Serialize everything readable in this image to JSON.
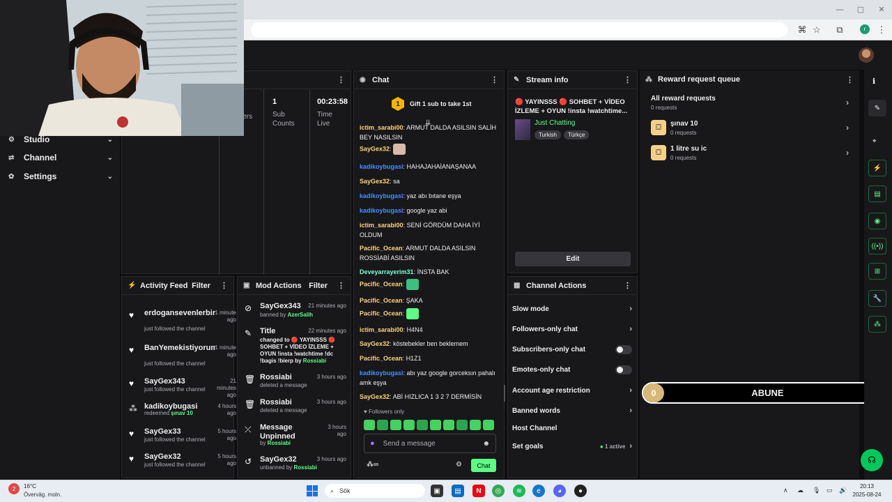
{
  "browser": {
    "window_controls": [
      "—",
      "▢",
      "✕"
    ]
  },
  "sidebar": {
    "items": [
      {
        "label": "Studio",
        "icon": "studio-icon"
      },
      {
        "label": "Channel",
        "icon": "channel-icon"
      },
      {
        "label": "Settings",
        "icon": "gear-icon"
      }
    ]
  },
  "stats": {
    "partial_label": "wers",
    "sub_value": "1",
    "sub_label": "Sub Counts",
    "time_value": "00:23:58",
    "time_label": "Time Live"
  },
  "chat": {
    "title": "Chat",
    "gift_banner": "Gift 1 sub to take 1st",
    "gift_count": "1",
    "messages": [
      {
        "user": "ictim_sarabi00",
        "color": "#ffd37a",
        "text": "ARMUT DALDA ASILSIN SALİH BEY NASILSIN"
      },
      {
        "user": "SayGex32",
        "color": "#ffd37a",
        "text": ""
      },
      {
        "user": "kadikoybugasi",
        "color": "#4a8cff",
        "text": "HAHAJAHAİANAŞANAA"
      },
      {
        "user": "SayGex32",
        "color": "#ffd37a",
        "text": "sa"
      },
      {
        "user": "kadikoybugasi",
        "color": "#4a8cff",
        "text": "yaz abı bıtane eşya"
      },
      {
        "user": "kadikoybugasi",
        "color": "#4a8cff",
        "text": "google yaz abi"
      },
      {
        "user": "ictim_sarabi00",
        "color": "#ffd37a",
        "text": "SENİ GÖRDÜM DAHA İYİ OLDUM"
      },
      {
        "user": "Pacific_Ocean",
        "color": "#ffd37a",
        "text": "ARMUT DALDA ASILSIN ROSSİABİ ASILSIN"
      },
      {
        "user": "Deveyarrayerim31",
        "color": "#7fffd4",
        "text": "İNSTA BAK"
      },
      {
        "user": "Pacific_Ocean",
        "color": "#ffd37a",
        "text": ""
      },
      {
        "user": "Pacific_Ocean",
        "color": "#ffd37a",
        "text": "ŞAKA"
      },
      {
        "user": "Pacific_Ocean",
        "color": "#ffd37a",
        "text": ""
      },
      {
        "user": "ictim_sarabi00",
        "color": "#ffd37a",
        "text": "H4N4"
      },
      {
        "user": "SayGex32",
        "color": "#ffd37a",
        "text": "köstebekler ben beklemem"
      },
      {
        "user": "Pacific_Ocean",
        "color": "#ffd37a",
        "text": "H1Z1"
      },
      {
        "user": "kadikoybugasi",
        "color": "#4a8cff",
        "text": "abı yaz google gorceksın pahalı amk eşya"
      },
      {
        "user": "SayGex32",
        "color": "#ffd37a",
        "text": "ABİ HIZLICA 1 3 2 7 DERMİSİN"
      }
    ],
    "followers_only": "Followers only",
    "placeholder": "Send a message",
    "chat_button": "Chat"
  },
  "stream_info": {
    "title": "Stream info",
    "stream_title": "🔴 YAYINSSS 🔴 SOHBET + VİDEO İZLEME + OYUN !insta !watchtime...",
    "category": "Just Chatting",
    "tags": [
      "Turkish",
      "Türkçe"
    ],
    "edit_button": "Edit"
  },
  "reward_queue": {
    "title": "Reward request queue",
    "all_label": "All reward requests",
    "all_count": "0 requests",
    "rewards": [
      {
        "name": "şınav 10",
        "count": "0 requests"
      },
      {
        "name": "1 litre su ic",
        "count": "0 requests"
      }
    ]
  },
  "activity_feed": {
    "title": "Activity Feed",
    "filter": "Filter",
    "items": [
      {
        "name": "erdogansevenlerbirligi",
        "time": "1 minute ago",
        "sub": "just followed the channel",
        "icon": "heart-icon"
      },
      {
        "name": "BanYemekistiyorum32",
        "time": "1 minute ago",
        "sub": "just followed the channel",
        "icon": "heart-icon"
      },
      {
        "name": "SayGex343",
        "time": "21 minutes ago",
        "sub": "just followed the channel",
        "icon": "heart-icon"
      },
      {
        "name": "kadikoybugasi",
        "time": "4 hours ago",
        "sub": "redeemed",
        "reward": "şınav 10",
        "icon": "points-icon"
      },
      {
        "name": "SayGex33",
        "time": "5 hours ago",
        "sub": "just followed the channel",
        "icon": "heart-icon"
      },
      {
        "name": "SayGex32",
        "time": "5 hours ago",
        "sub": "just followed the channel",
        "icon": "heart-icon"
      }
    ]
  },
  "mod_actions": {
    "title": "Mod Actions",
    "filter": "Filter",
    "items": [
      {
        "name": "SayGex343",
        "time": "21 minutes ago",
        "sub": "banned by",
        "by": "AzerSalih",
        "icon": "ban-icon"
      },
      {
        "name": "Title",
        "time": "22 minutes ago",
        "sub": "changed to 🔴 YAYINSSS 🔴 SOHBET + VİDEO İZLEME + OYUN !insta !watchtime !dc !bagis !bierp by",
        "by": "Rossiabi",
        "icon": "edit-title-icon"
      },
      {
        "name": "Rossiabi",
        "time": "3 hours ago",
        "sub": "deleted a message",
        "by": "",
        "icon": "trash-icon"
      },
      {
        "name": "Rossiabi",
        "time": "3 hours ago",
        "sub": "deleted a message",
        "by": "",
        "icon": "trash-icon"
      },
      {
        "name": "Message Unpinned",
        "time": "3 hours ago",
        "sub": "by",
        "by": "Rossiabi",
        "icon": "unpin-icon"
      },
      {
        "name": "SayGex32",
        "time": "3 hours ago",
        "sub": "unbanned by",
        "by": "Rossiabi",
        "icon": "unban-icon"
      }
    ]
  },
  "channel_actions": {
    "title": "Channel Actions",
    "items": [
      {
        "label": "Slow mode",
        "type": "chevron"
      },
      {
        "label": "Followers-only chat",
        "type": "chevron"
      },
      {
        "label": "Subscribers-only chat",
        "type": "toggle"
      },
      {
        "label": "Emotes-only chat",
        "type": "toggle"
      },
      {
        "label": "Account age restriction",
        "type": "chevron"
      },
      {
        "label": "Banned words",
        "type": "chevron"
      },
      {
        "label": "Host Channel",
        "type": "none"
      },
      {
        "label": "Set goals",
        "type": "chevron",
        "extra": "1 active"
      }
    ]
  },
  "abune_bar": {
    "left": "0",
    "label": "ABUNE",
    "right": "5"
  },
  "taskbar": {
    "weather_temp": "16°C",
    "weather_text": "Överväg. moln.",
    "weather_badge": "2",
    "search": "Sök",
    "time": "20:13",
    "date": "2025-08-24"
  },
  "colors": {
    "accent": "#5cff84",
    "bg": "#0e0e10",
    "panel": "#18181b"
  }
}
